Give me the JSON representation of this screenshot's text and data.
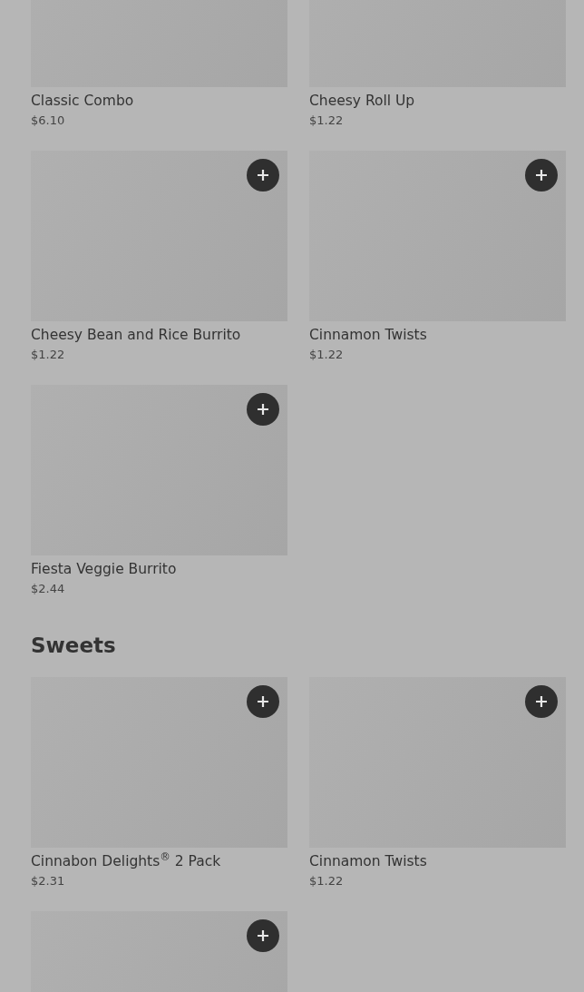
{
  "sections": [
    {
      "items": [
        {
          "kind": "top_cropped",
          "name": "Classic Combo",
          "price": "$6.10"
        },
        {
          "kind": "top_cropped",
          "name": "Cheesy Roll Up",
          "price": "$1.22"
        },
        {
          "kind": "card",
          "name": "Cheesy Bean and Rice Burrito",
          "price": "$1.22"
        },
        {
          "kind": "card",
          "name": "Cinnamon Twists",
          "price": "$1.22"
        },
        {
          "kind": "card",
          "name": "Fiesta Veggie Burrito",
          "price": "$2.44"
        }
      ]
    },
    {
      "heading": "Sweets",
      "items": [
        {
          "kind": "card",
          "name": "Cinnabon Delights$^{®}$ 2 Pack",
          "price": "$2.31"
        },
        {
          "kind": "card",
          "name": "Cinnamon Twists",
          "price": "$1.22"
        },
        {
          "kind": "image_only"
        }
      ]
    }
  ]
}
